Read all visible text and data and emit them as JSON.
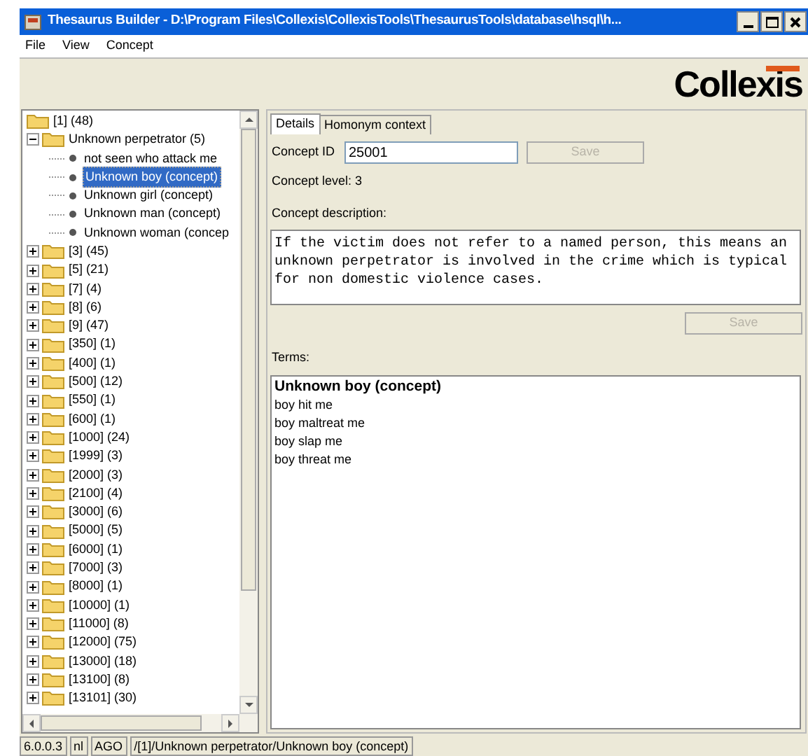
{
  "window": {
    "title": "Thesaurus Builder - D:\\Program Files\\Collexis\\CollexisTools\\ThesaurusTools\\database\\hsql\\h..."
  },
  "menu": [
    "File",
    "View",
    "Concept"
  ],
  "logo": {
    "text": "Collexis"
  },
  "tree": [
    {
      "label": "[1] (48)",
      "kind": "folder",
      "selected": false,
      "children": [
        {
          "label": "Unknown perpetrator (5)",
          "kind": "folder",
          "expanded": true,
          "selected": false,
          "children": [
            {
              "label": "not seen who attack me",
              "kind": "leaf",
              "selected": false
            },
            {
              "label": "Unknown boy (concept)",
              "kind": "leaf",
              "selected": true
            },
            {
              "label": "Unknown girl (concept)",
              "kind": "leaf",
              "selected": false
            },
            {
              "label": "Unknown man (concept)",
              "kind": "leaf",
              "selected": false
            },
            {
              "label": "Unknown woman (concep",
              "kind": "leaf",
              "selected": false
            }
          ]
        },
        {
          "label": "[3] (45)",
          "kind": "folder",
          "expanded": false,
          "selected": false
        },
        {
          "label": "[5] (21)",
          "kind": "folder",
          "expanded": false,
          "selected": false
        },
        {
          "label": "[7] (4)",
          "kind": "folder",
          "expanded": false,
          "selected": false
        },
        {
          "label": "[8] (6)",
          "kind": "folder",
          "expanded": false,
          "selected": false
        },
        {
          "label": "[9] (47)",
          "kind": "folder",
          "expanded": false,
          "selected": false
        },
        {
          "label": "[350] (1)",
          "kind": "folder",
          "expanded": false,
          "selected": false
        },
        {
          "label": "[400] (1)",
          "kind": "folder",
          "expanded": false,
          "selected": false
        },
        {
          "label": "[500] (12)",
          "kind": "folder",
          "expanded": false,
          "selected": false
        },
        {
          "label": "[550] (1)",
          "kind": "folder",
          "expanded": false,
          "selected": false
        },
        {
          "label": "[600] (1)",
          "kind": "folder",
          "expanded": false,
          "selected": false
        },
        {
          "label": "[1000] (24)",
          "kind": "folder",
          "expanded": false,
          "selected": false
        },
        {
          "label": "[1999] (3)",
          "kind": "folder",
          "expanded": false,
          "selected": false
        },
        {
          "label": "[2000] (3)",
          "kind": "folder",
          "expanded": false,
          "selected": false
        },
        {
          "label": "[2100] (4)",
          "kind": "folder",
          "expanded": false,
          "selected": false
        },
        {
          "label": "[3000] (6)",
          "kind": "folder",
          "expanded": false,
          "selected": false
        },
        {
          "label": "[5000] (5)",
          "kind": "folder",
          "expanded": false,
          "selected": false
        },
        {
          "label": "[6000] (1)",
          "kind": "folder",
          "expanded": false,
          "selected": false
        },
        {
          "label": "[7000] (3)",
          "kind": "folder",
          "expanded": false,
          "selected": false
        },
        {
          "label": "[8000] (1)",
          "kind": "folder",
          "expanded": false,
          "selected": false
        },
        {
          "label": "[10000] (1)",
          "kind": "folder",
          "expanded": false,
          "selected": false
        },
        {
          "label": "[11000] (8)",
          "kind": "folder",
          "expanded": false,
          "selected": false
        },
        {
          "label": "[12000] (75)",
          "kind": "folder",
          "expanded": false,
          "selected": false
        },
        {
          "label": "[13000] (18)",
          "kind": "folder",
          "expanded": false,
          "selected": false
        },
        {
          "label": "[13100] (8)",
          "kind": "folder",
          "expanded": false,
          "selected": false
        },
        {
          "label": "[13101] (30)",
          "kind": "folder",
          "expanded": false,
          "selected": false
        }
      ]
    }
  ],
  "tabs": [
    {
      "label": "Details",
      "selected": true
    },
    {
      "label": "Homonym context",
      "selected": false
    }
  ],
  "concept_id": {
    "label": "Concept ID",
    "value": "25001",
    "save_button": {
      "label": "Save",
      "disabled": true
    }
  },
  "concept_level": "Concept level: 3",
  "description": {
    "label": "Concept description:",
    "text": "If the victim does not refer to a named person, this means an unknown perpetrator is involved in the crime which is typical for non domestic violence cases.",
    "save_button": {
      "label": "Save",
      "disabled": true
    }
  },
  "terms": {
    "label": "Terms:",
    "items": [
      {
        "text": "Unknown boy (concept)",
        "kind": "concept"
      },
      {
        "text": "boy hit me",
        "kind": "term"
      },
      {
        "text": "boy maltreat me",
        "kind": "term"
      },
      {
        "text": "boy slap me",
        "kind": "term"
      },
      {
        "text": "boy threat me",
        "kind": "term"
      }
    ]
  },
  "status_bar": [
    "6.0.0.3",
    "nl",
    "AGO",
    "/[1]/Unknown perpetrator/Unknown boy (concept)"
  ]
}
